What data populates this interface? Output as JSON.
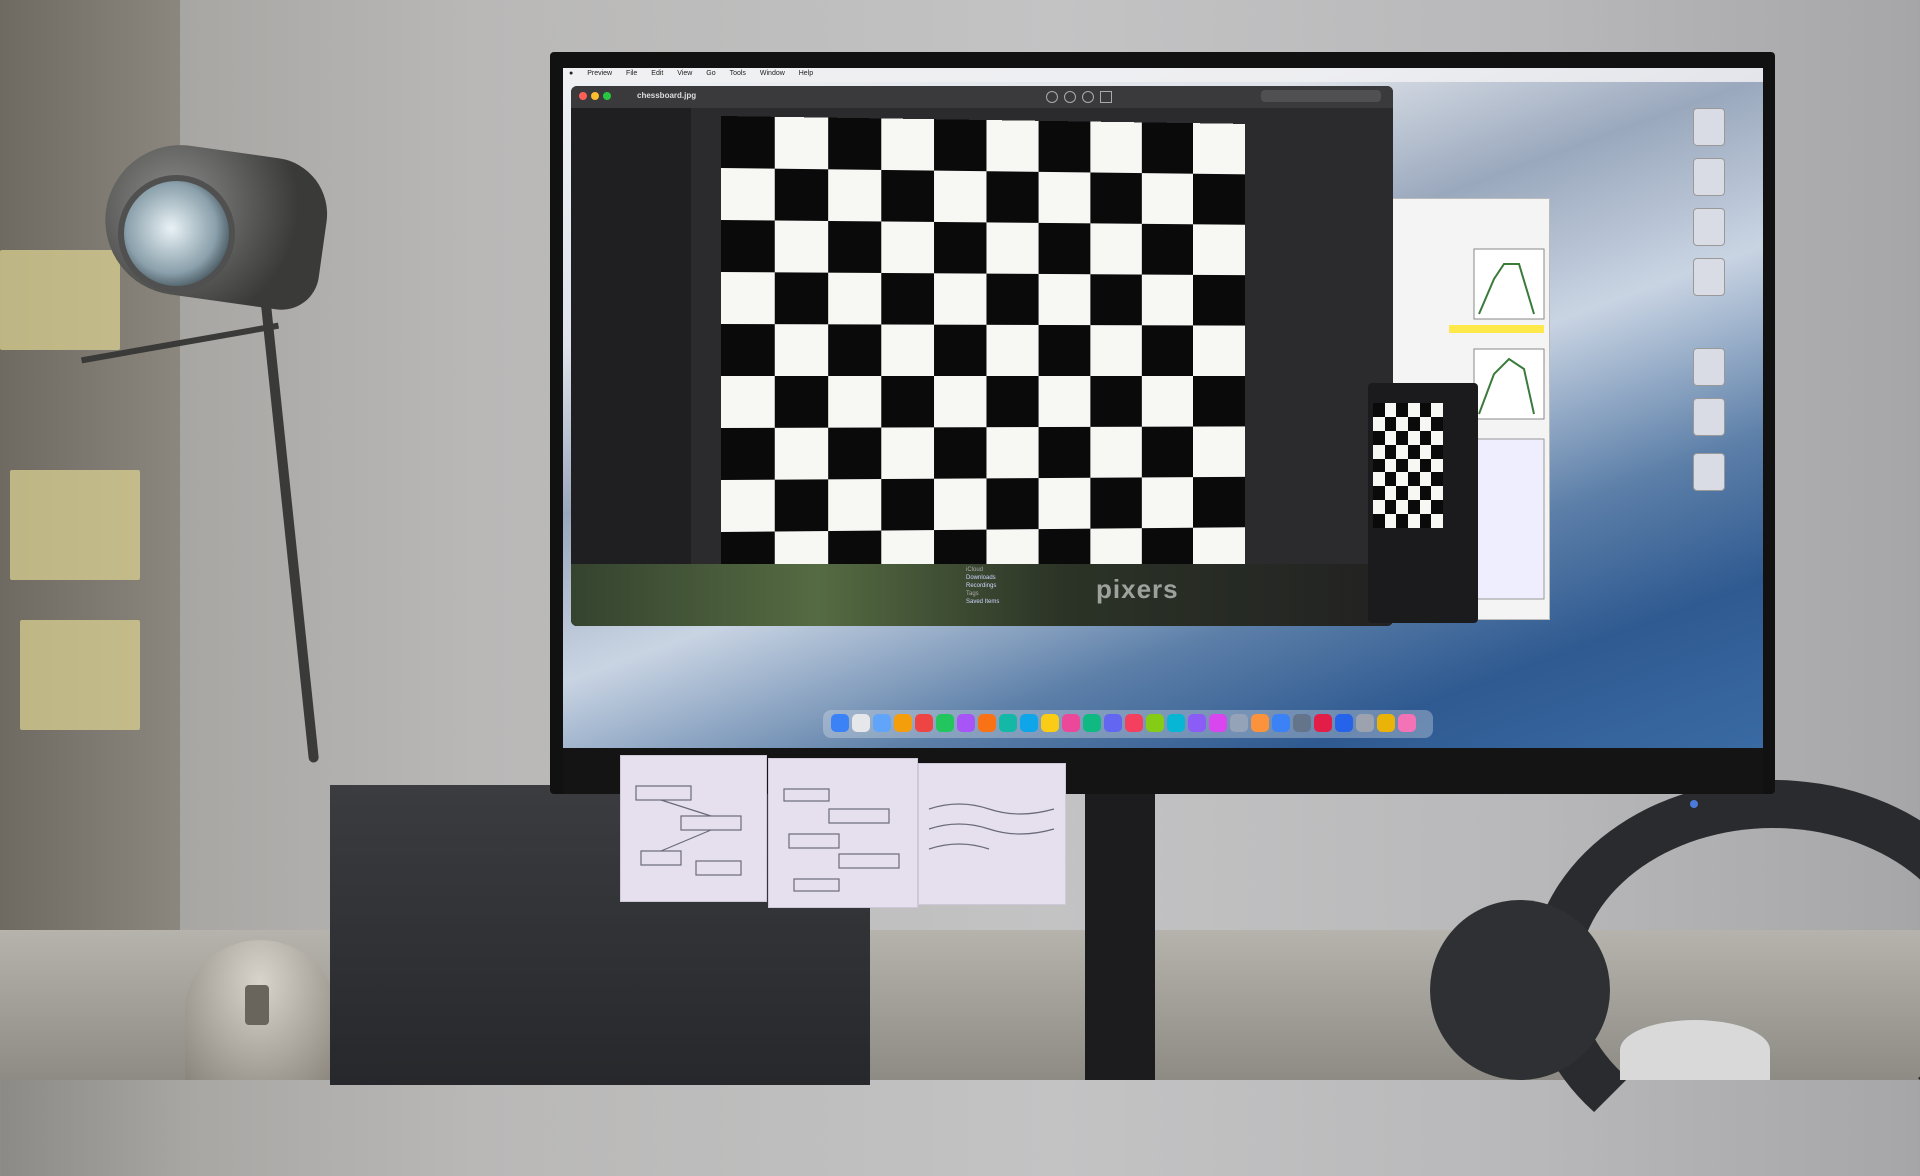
{
  "scene": {
    "monitor_window_title": "chessboard.jpg",
    "menubar_items": [
      "Preview",
      "File",
      "Edit",
      "View",
      "Go",
      "Tools",
      "Window",
      "Help"
    ],
    "watermark": "pixers",
    "sidebar_entries": [
      "Downloads",
      "Recordings",
      "Saved Items"
    ],
    "sidebar_section_labels": [
      "iCloud",
      "Tags"
    ]
  }
}
